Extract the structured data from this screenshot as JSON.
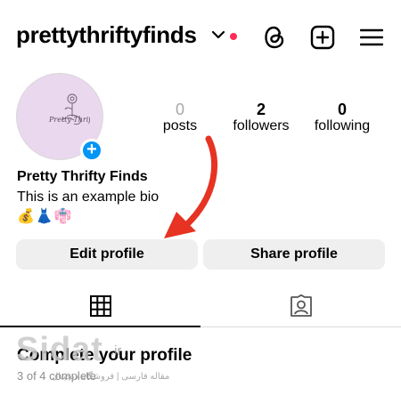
{
  "header": {
    "username": "prettythriftyfinds",
    "icons": [
      "chevron-down-icon",
      "notification-dot",
      "threads-icon",
      "create-icon",
      "menu-icon"
    ]
  },
  "profile": {
    "avatar_logo_text": "Pretty Thrifty Finds",
    "stats": {
      "posts": {
        "count": "0",
        "label": "posts"
      },
      "followers": {
        "count": "2",
        "label": "followers"
      },
      "following": {
        "count": "0",
        "label": "following"
      }
    },
    "display_name": "Pretty Thrifty Finds",
    "bio": "This is an example bio",
    "emojis": "💰👗👘"
  },
  "buttons": {
    "edit_profile": "Edit profile",
    "share_profile": "Share profile"
  },
  "tabs": [
    {
      "icon": "grid-icon",
      "active": true
    },
    {
      "icon": "tagged-icon",
      "active": false
    }
  ],
  "complete_profile": {
    "title": "Complete your profile",
    "progress": "3 of 4 complete"
  },
  "watermark": {
    "latin": "Sidat",
    "suffix": ".ir",
    "persian": "مقاله فارسی | فروشگاه دیجیتال"
  },
  "colors": {
    "accent_blue": "#0095f6",
    "annotation_red": "#e63323",
    "notification_red": "#ff2d55",
    "button_gray": "#efefef"
  }
}
